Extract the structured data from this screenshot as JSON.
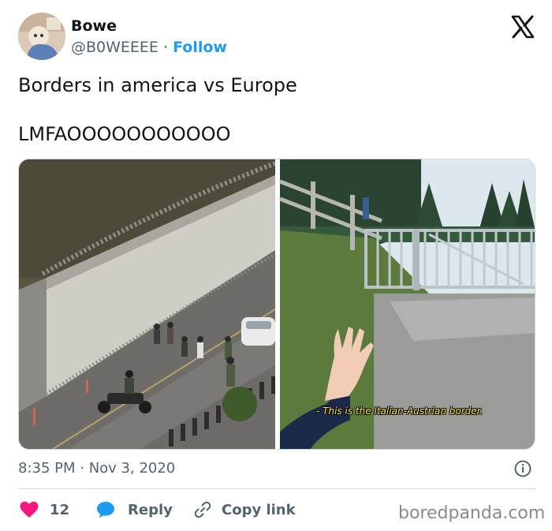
{
  "tweet": {
    "author_name": "Bowe",
    "author_handle": "@B0WEEEE",
    "follow_label": "Follow",
    "separator": "·",
    "lines": [
      "Borders in america vs Europe",
      "LMFAOOOOOOOOOOO"
    ],
    "media_caption": "- This is the Italian-Austrian border.",
    "timestamp": "8:35 PM · Nov 3, 2020"
  },
  "actions": {
    "likes_count": "12",
    "reply_label": "Reply",
    "copy_link_label": "Copy link"
  },
  "watermark": "boredpanda.com",
  "colors": {
    "link_blue": "#1d9bf0",
    "like_red": "#f91880",
    "secondary_text": "#536471",
    "divider": "#cfd9de"
  },
  "icons": {
    "platform": "x-logo-icon",
    "info": "info-icon",
    "like": "heart-icon",
    "reply": "speech-bubble-icon",
    "copy_link": "link-icon"
  }
}
